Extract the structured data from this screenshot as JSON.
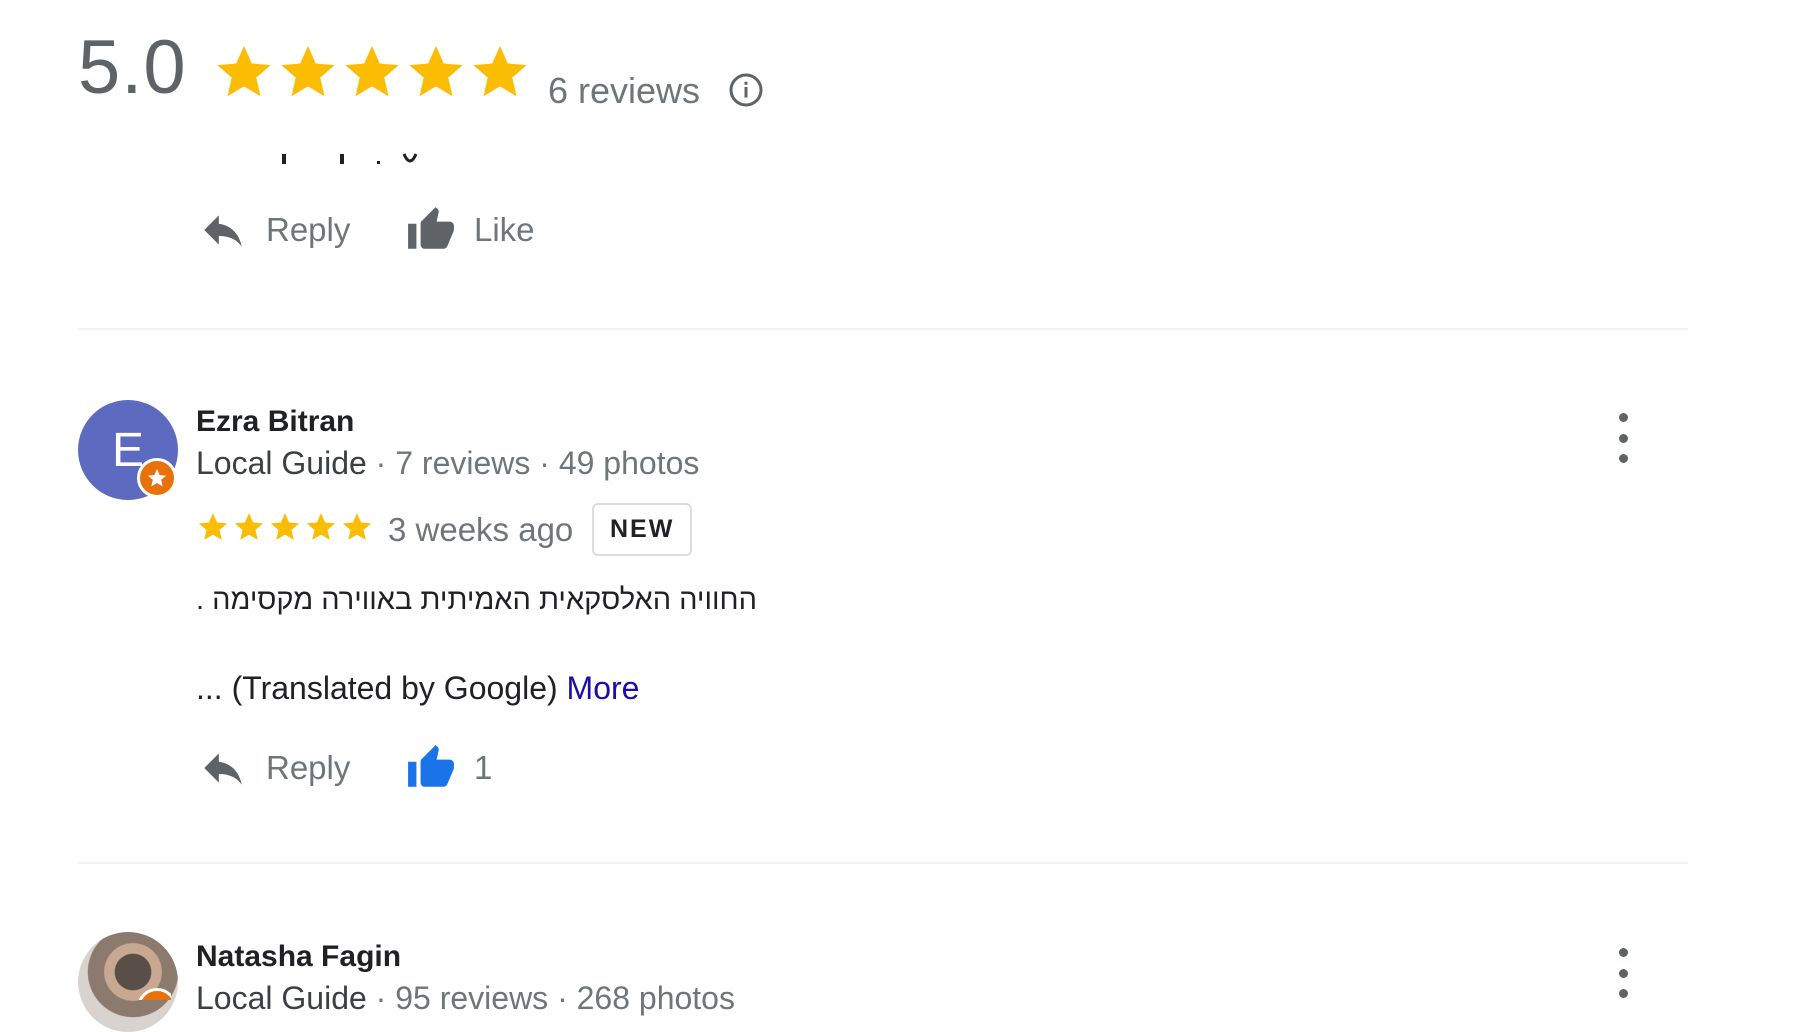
{
  "summary": {
    "rating": "5.0",
    "stars": 5,
    "reviews_label": "6 reviews"
  },
  "previous_review": {
    "reply_label": "Reply",
    "like_label": "Like"
  },
  "reviews": [
    {
      "avatar_letter": "E",
      "avatar_color": "#5c6bc0",
      "name": "Ezra Bitran",
      "guide": "Local Guide",
      "stats": " · 7 reviews · 49 photos",
      "stars": 5,
      "time": "3 weeks ago",
      "badge": "NEW",
      "text": "החוויה האלסקאית האמיתית  באווירה מקסימה .",
      "translated_prefix": "... (Translated by Google)",
      "more_label": "More",
      "reply_label": "Reply",
      "like_count": "1"
    },
    {
      "name": "Natasha Fagin",
      "guide": "Local Guide",
      "stats": " · 95 reviews · 268 photos"
    }
  ],
  "colors": {
    "star": "#fbbc04",
    "like_active": "#1a73e8",
    "icon_gray": "#5f6368",
    "guide_badge": "#e8710a",
    "link": "#1a0dab"
  },
  "icons": [
    "star-icon",
    "info-icon",
    "reply-icon",
    "thumbs-up-icon",
    "more-vert-icon",
    "local-guide-badge-icon"
  ]
}
